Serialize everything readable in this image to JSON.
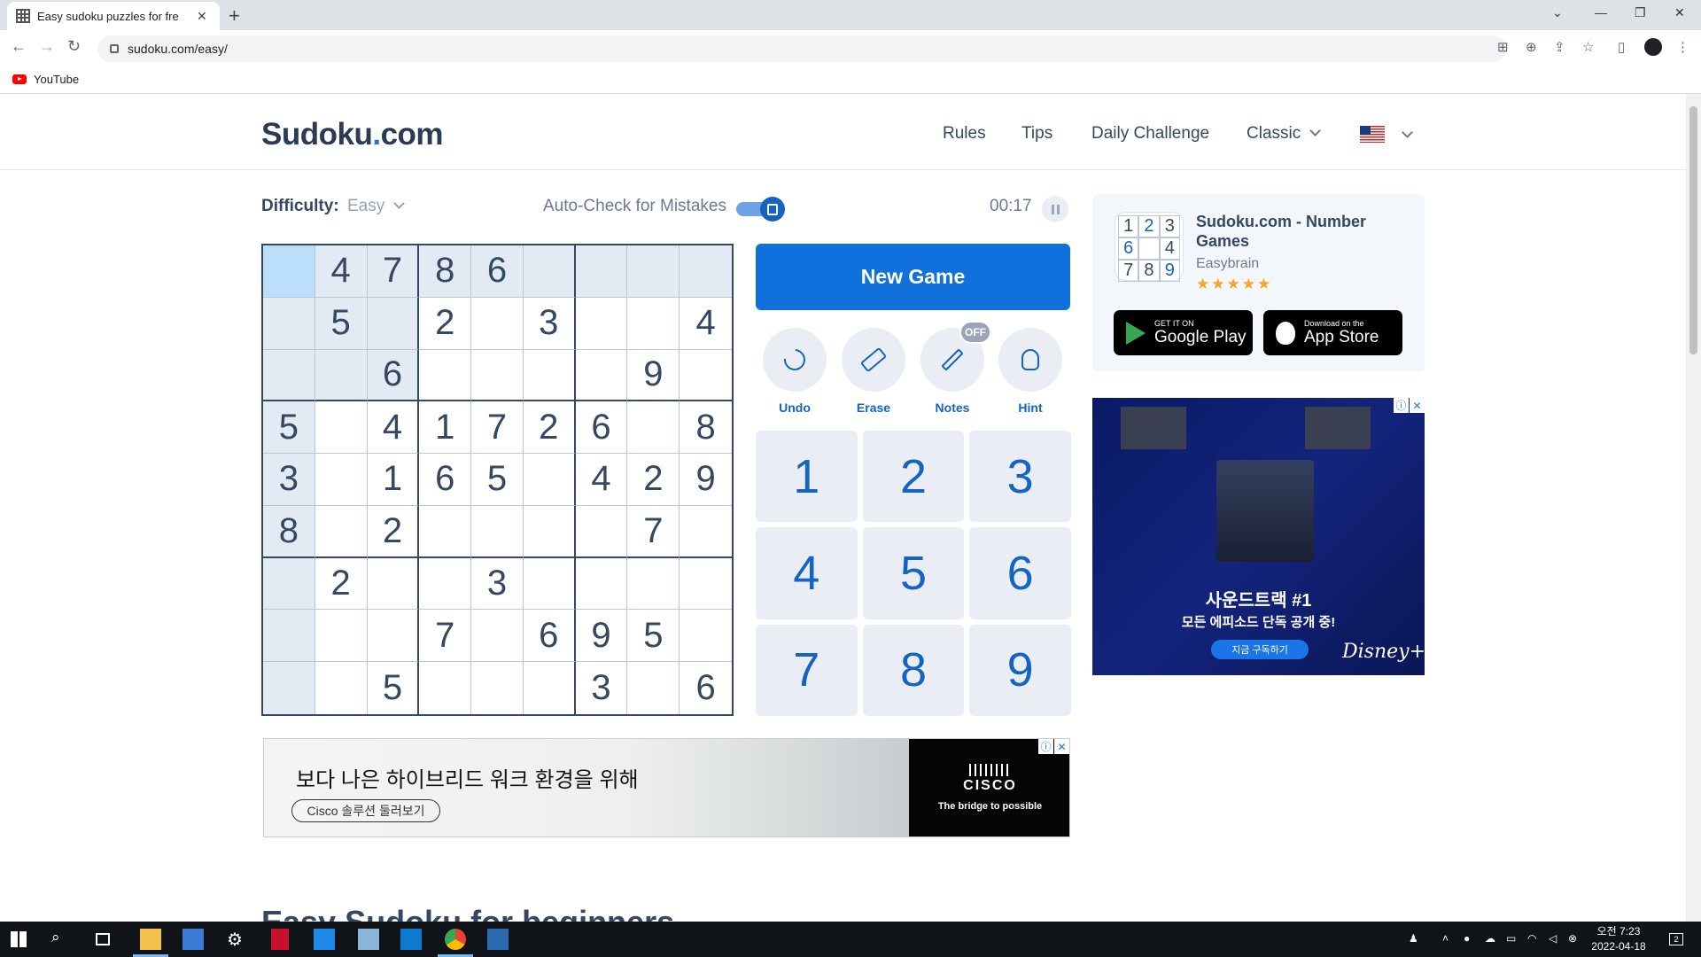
{
  "browser": {
    "tab_title": "Easy sudoku puzzles for fre",
    "url": "sudoku.com/easy/",
    "bookmark_label": "YouTube"
  },
  "header": {
    "logo_main": "Sudoku",
    "logo_dot": ".",
    "logo_tld": "com",
    "nav": {
      "rules": "Rules",
      "tips": "Tips",
      "daily": "Daily Challenge",
      "classic": "Classic"
    }
  },
  "controls": {
    "difficulty_label": "Difficulty:",
    "difficulty_value": "Easy",
    "autocheck_label": "Auto-Check for Mistakes",
    "autocheck_on": true,
    "timer": "00:17"
  },
  "board": {
    "selected_row": 0,
    "selected_col": 0,
    "rows": [
      [
        "",
        "4",
        "7",
        "8",
        "6",
        "",
        "",
        "",
        ""
      ],
      [
        "",
        "5",
        "",
        "2",
        "",
        "3",
        "",
        "",
        "4"
      ],
      [
        "",
        "",
        "6",
        "",
        "",
        "",
        "",
        "9",
        ""
      ],
      [
        "5",
        "",
        "4",
        "1",
        "7",
        "2",
        "6",
        "",
        "8"
      ],
      [
        "3",
        "",
        "1",
        "6",
        "5",
        "",
        "4",
        "2",
        "9"
      ],
      [
        "8",
        "",
        "2",
        "",
        "",
        "",
        "",
        "7",
        ""
      ],
      [
        "",
        "2",
        "",
        "",
        "3",
        "",
        "",
        "",
        ""
      ],
      [
        "",
        "",
        "",
        "7",
        "",
        "6",
        "9",
        "5",
        ""
      ],
      [
        "",
        "",
        "5",
        "",
        "",
        "",
        "3",
        "",
        "6"
      ]
    ]
  },
  "actions": {
    "new_game": "New Game",
    "undo": "Undo",
    "erase": "Erase",
    "notes": "Notes",
    "notes_badge": "OFF",
    "hint": "Hint"
  },
  "numpad": [
    "1",
    "2",
    "3",
    "4",
    "5",
    "6",
    "7",
    "8",
    "9"
  ],
  "promo": {
    "title": "Sudoku.com - Number Games",
    "developer": "Easybrain",
    "stars": "★★★★★",
    "rating": 4.5,
    "icon_digits": [
      "1",
      "2",
      "3",
      "6",
      "",
      "4",
      "7",
      "8",
      "9"
    ],
    "google_small": "GET IT ON",
    "google_big": "Google Play",
    "apple_small": "Download on the",
    "apple_big": "App Store"
  },
  "ad_disney": {
    "line1": "사운드트랙 #1",
    "line2": "모든 에피소드 단독 공개 중!",
    "button": "지금 구독하기",
    "brand": "Disney+"
  },
  "ad_cisco": {
    "headline": "보다 나은 하이브리드 워크 환경을 위해",
    "button": "Cisco 솔루션 둘러보기",
    "logo": "CISCO",
    "tagline": "The bridge to possible"
  },
  "below_fold_title": "Easy Sudoku for beginners",
  "taskbar": {
    "time": "오전 7:23",
    "date": "2022-04-18",
    "notification_count": "2"
  }
}
